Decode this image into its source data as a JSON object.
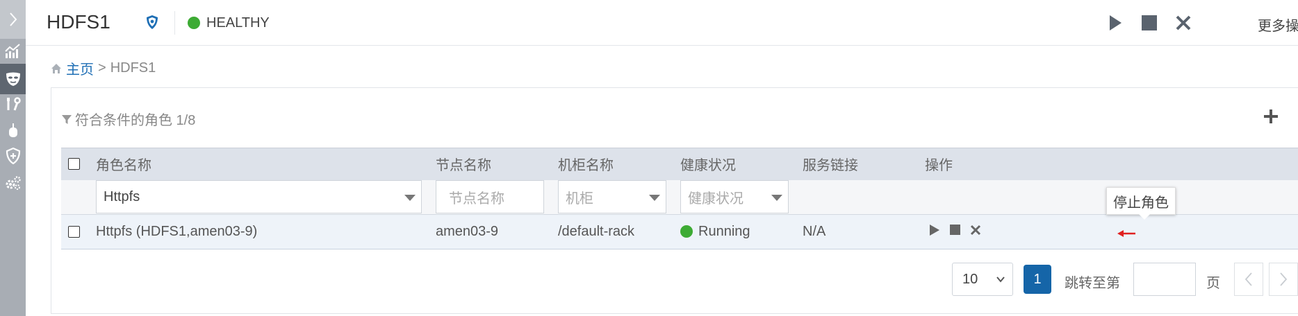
{
  "header": {
    "title": "HDFS1",
    "health_status": "HEALTHY",
    "more_actions": "更多操作 ▼"
  },
  "breadcrumb": {
    "home": "主页",
    "separator": ">",
    "current": "HDFS1"
  },
  "panel": {
    "filter_summary": "符合条件的角色 1/8"
  },
  "table": {
    "columns": [
      "角色名称",
      "节点名称",
      "机柜名称",
      "健康状况",
      "服务链接",
      "操作"
    ],
    "filters": {
      "role": "Httpfs",
      "node_placeholder": "节点名称",
      "rack_placeholder": "机柜",
      "health_placeholder": "健康状况"
    },
    "rows": [
      {
        "role": "Httpfs (HDFS1,amen03-9)",
        "node": "amen03-9",
        "rack": "/default-rack",
        "health": "Running",
        "link": "N/A"
      }
    ]
  },
  "tooltip": "停止角色",
  "pagination": {
    "page_size": "10",
    "current_page": "1",
    "jump_label": "跳转至第",
    "page_suffix": "页"
  },
  "colors": {
    "healthy": "#3dab34",
    "accent": "#1565a8",
    "sidebar": "#a8adb4",
    "sidebar_active": "#5e6670"
  },
  "icons": {
    "sidebar": [
      "chevron-right-icon",
      "chart-icon",
      "mask-icon",
      "tools-icon",
      "mouse-icon",
      "shield-plus-icon",
      "gears-icon"
    ],
    "header": [
      "shield-badge-icon",
      "play-icon",
      "stop-icon",
      "close-icon"
    ]
  }
}
